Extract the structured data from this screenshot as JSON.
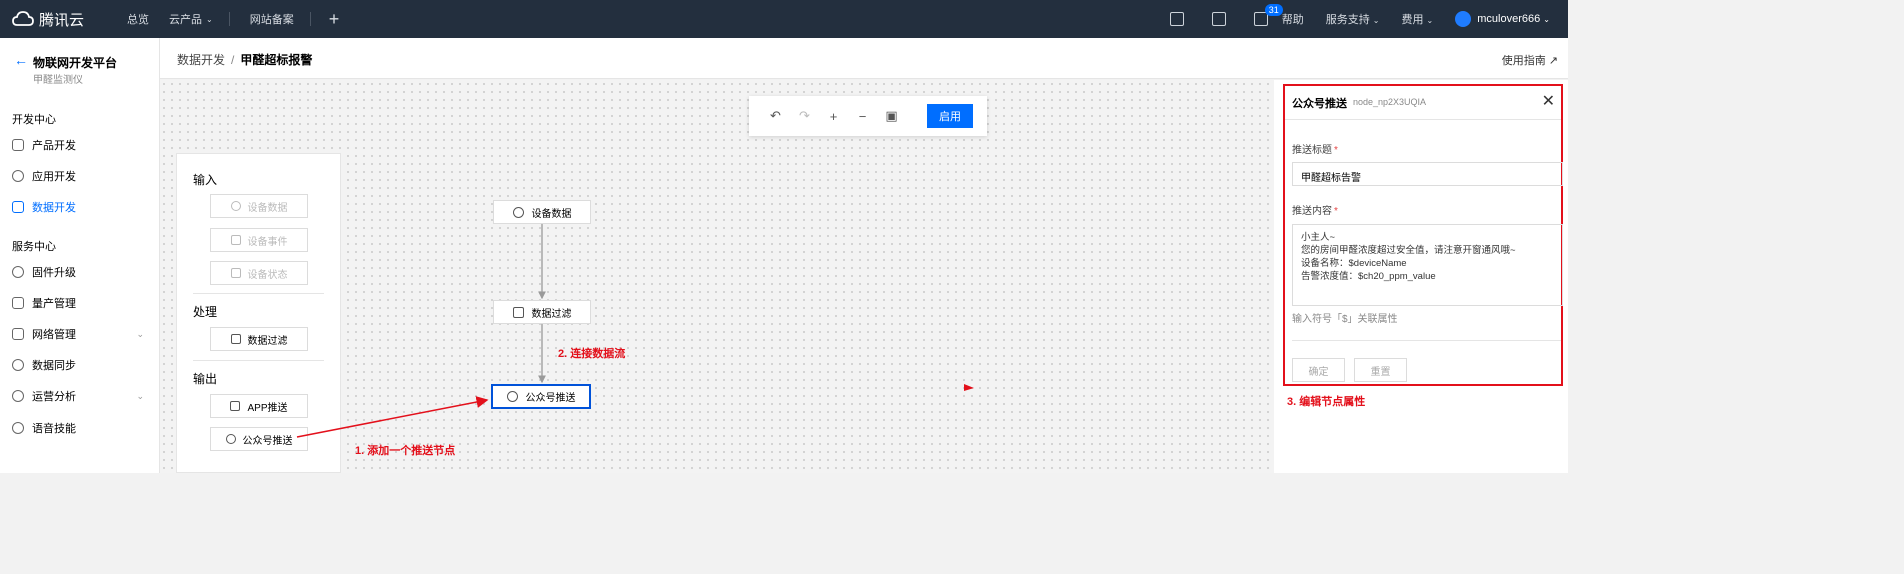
{
  "topbar": {
    "brand": "腾讯云",
    "nav": [
      "总览",
      "云产品",
      "网站备案"
    ],
    "mail_badge": "31",
    "help": "帮助",
    "support": "服务支持",
    "billing": "费用",
    "username": "mculover666"
  },
  "sidebar": {
    "title": "物联网开发平台",
    "subtitle": "甲醛监测仪",
    "dev_center": "开发中心",
    "dev_items": [
      "产品开发",
      "应用开发",
      "数据开发"
    ],
    "service_center": "服务中心",
    "service_items": [
      "固件升级",
      "量产管理",
      "网络管理",
      "数据同步",
      "运营分析",
      "语音技能"
    ]
  },
  "header": {
    "crumb_parent": "数据开发",
    "crumb_current": "甲醛超标报警",
    "guide": "使用指南"
  },
  "toolbar": {
    "enable": "启用"
  },
  "palette": {
    "input_title": "输入",
    "input_nodes": [
      "设备数据",
      "设备事件",
      "设备状态"
    ],
    "process_title": "处理",
    "process_nodes": [
      "数据过滤"
    ],
    "output_title": "输出",
    "output_nodes": [
      "APP推送",
      "公众号推送"
    ]
  },
  "flow": {
    "nodes": [
      "设备数据",
      "数据过滤",
      "公众号推送"
    ]
  },
  "props": {
    "title": "公众号推送",
    "node_id": "node_np2X3UQIA",
    "title_label": "推送标题",
    "title_value": "甲醛超标告警",
    "content_label": "推送内容",
    "content_lines": [
      "小主人~",
      "您的房间甲醛浓度超过安全值，请注意开窗通风哦~",
      "设备名称：$deviceName",
      "告警浓度值：$ch20_ppm_value"
    ],
    "hint": "输入符号「$」关联属性",
    "ok": "确定",
    "reset": "重置"
  },
  "annotations": {
    "step1": "1. 添加一个推送节点",
    "step2": "2. 连接数据流",
    "step3": "3. 编辑节点属性"
  },
  "colors": {
    "topbar_bg": "#232f3e",
    "accent": "#006eff",
    "annotation": "#e3101b"
  }
}
